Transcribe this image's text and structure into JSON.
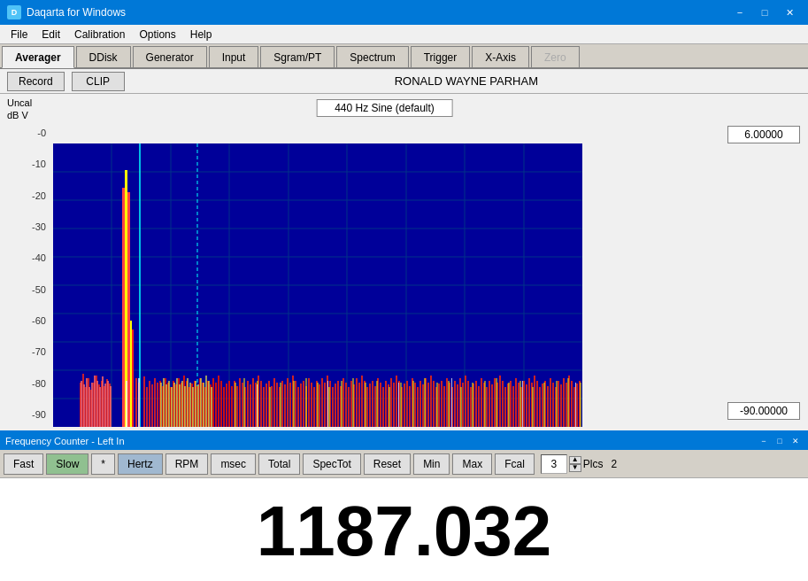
{
  "titleBar": {
    "title": "Daqarta for Windows",
    "icon": "D",
    "controls": [
      "minimize",
      "maximize",
      "close"
    ]
  },
  "menuBar": {
    "items": [
      "File",
      "Edit",
      "Calibration",
      "Options",
      "Help"
    ]
  },
  "tabs": [
    {
      "label": "Averager",
      "active": true
    },
    {
      "label": "DDisk",
      "active": false
    },
    {
      "label": "Generator",
      "active": false
    },
    {
      "label": "Input",
      "active": false
    },
    {
      "label": "Sgram/PT",
      "active": false
    },
    {
      "label": "Spectrum",
      "active": false
    },
    {
      "label": "Trigger",
      "active": false
    },
    {
      "label": "X-Axis",
      "active": false
    },
    {
      "label": "Zero",
      "active": false,
      "disabled": true
    }
  ],
  "toolbar": {
    "recordLabel": "Record",
    "clipLabel": "CLIP",
    "userName": "RONALD WAYNE PARHAM"
  },
  "chart": {
    "title": "440 Hz Sine (default)",
    "yAxisLabel": "Uncal",
    "yAxisUnit": "dB V",
    "yTicks": [
      "-0",
      "-10",
      "-20",
      "-30",
      "-40",
      "-50",
      "-60",
      "-70",
      "-80",
      "-90"
    ],
    "topValue": "6.00000",
    "bottomValue": "-90.00000"
  },
  "freqCounter": {
    "title": "Frequency Counter - Left In",
    "buttons": [
      "Fast",
      "Slow",
      "*",
      "Hertz",
      "RPM",
      "msec",
      "Total",
      "SpecTot",
      "Reset",
      "Min",
      "Max",
      "Fcal"
    ],
    "plcsValue": "3",
    "plcsLabel": "Plcs",
    "rightValue": "2",
    "display": "1187.032"
  }
}
